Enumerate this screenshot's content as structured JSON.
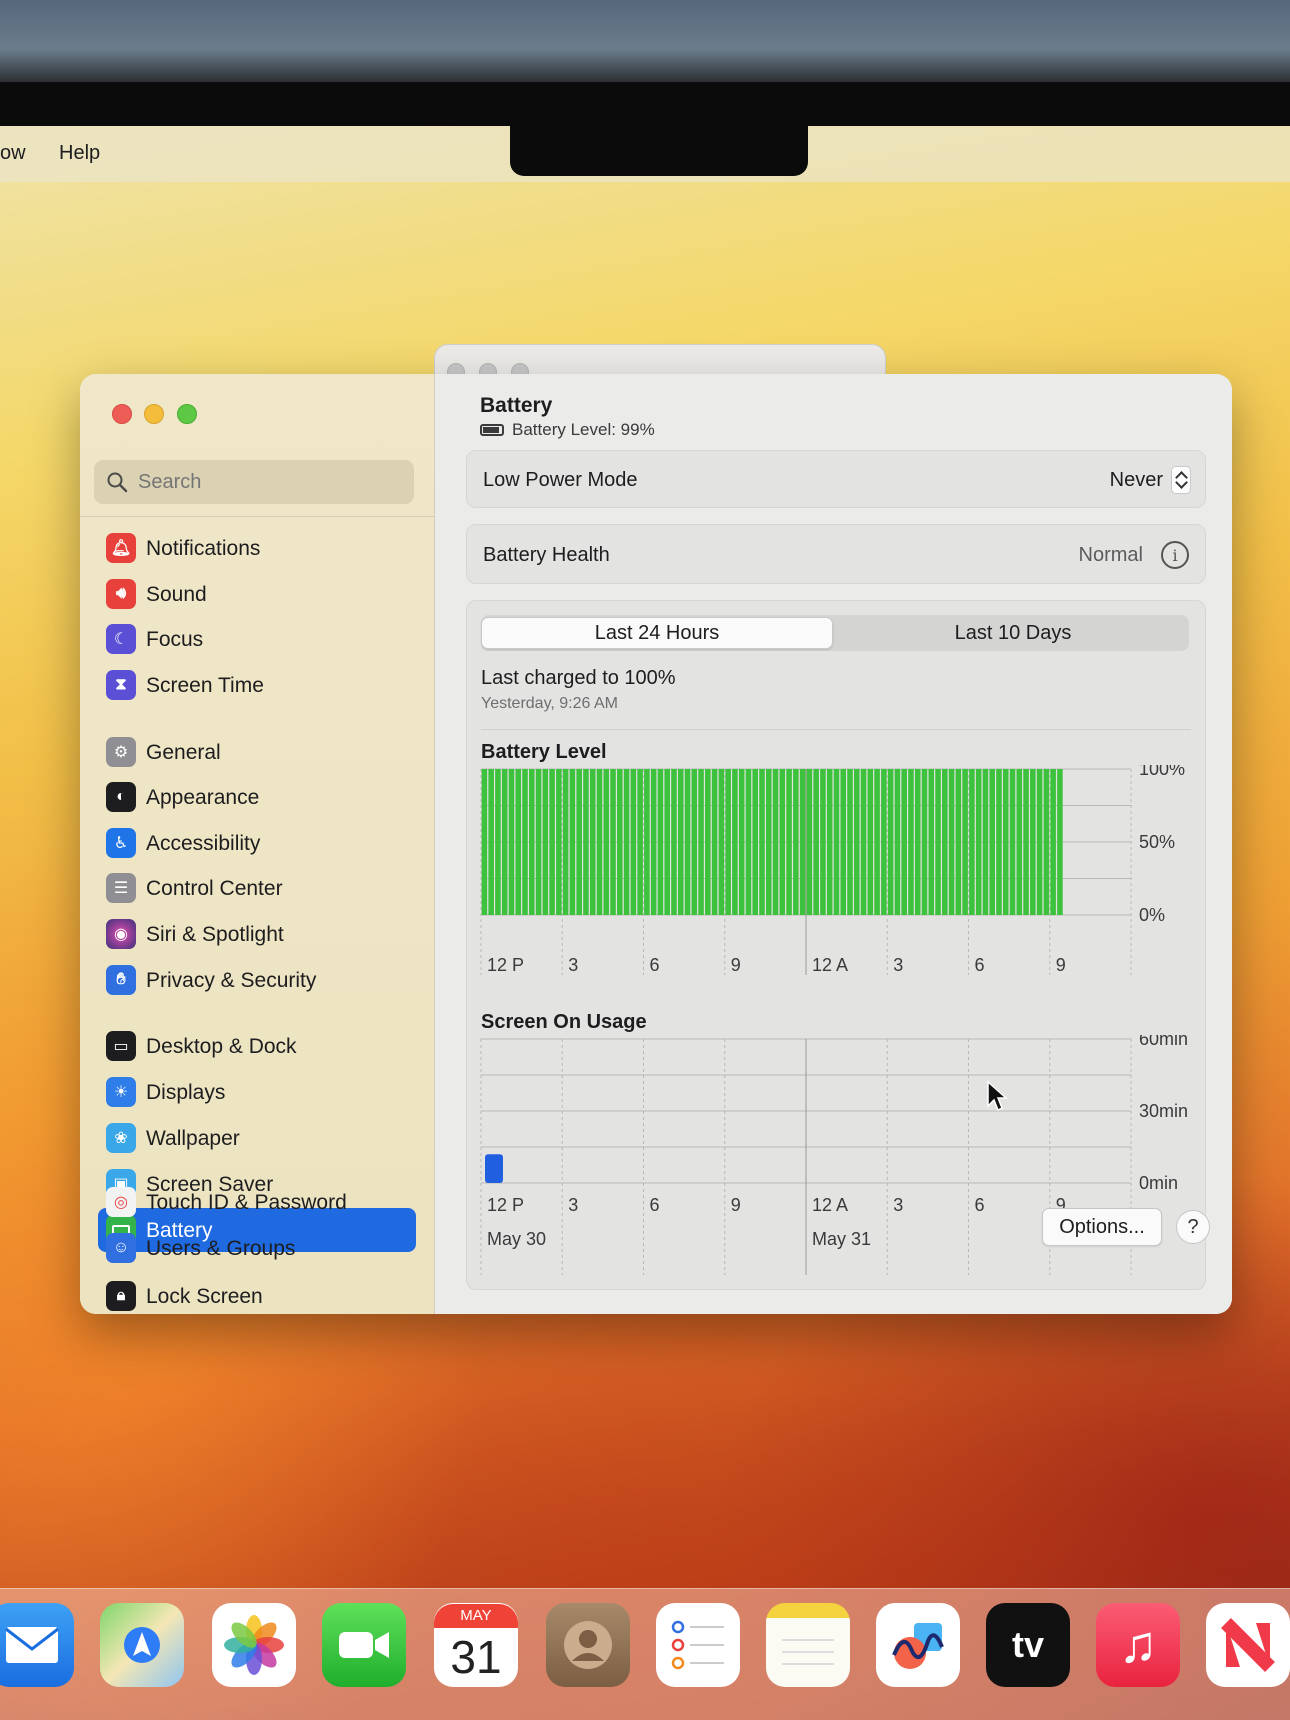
{
  "menubar": {
    "items": [
      "ow",
      "Help"
    ]
  },
  "sidebar": {
    "search_placeholder": "Search",
    "items": [
      {
        "label": "Notifications",
        "color": "#e8413c"
      },
      {
        "label": "Sound",
        "color": "#e8413c"
      },
      {
        "label": "Focus",
        "color": "#5b4fd6"
      },
      {
        "label": "Screen Time",
        "color": "#5b4fd6"
      },
      {
        "label": "General",
        "color": "#8e8e93"
      },
      {
        "label": "Appearance",
        "color": "#1d1d1f"
      },
      {
        "label": "Accessibility",
        "color": "#1f74e8"
      },
      {
        "label": "Control Center",
        "color": "#8e8e93"
      },
      {
        "label": "Siri & Spotlight",
        "color": "#3a2f7a"
      },
      {
        "label": "Privacy & Security",
        "color": "#2f6fe0"
      },
      {
        "label": "Desktop & Dock",
        "color": "#1d1d1f"
      },
      {
        "label": "Displays",
        "color": "#2f7de8"
      },
      {
        "label": "Wallpaper",
        "color": "#3aa7e8"
      },
      {
        "label": "Screen Saver",
        "color": "#3aa7e8"
      },
      {
        "label": "Battery",
        "color": "#33b34a"
      },
      {
        "label": "Lock Screen",
        "color": "#1d1d1f"
      },
      {
        "label": "Touch ID & Password",
        "color": "#f3f3f3"
      },
      {
        "label": "Users & Groups",
        "color": "#2f6fe0"
      }
    ],
    "selected": "Battery"
  },
  "main": {
    "title": "Battery",
    "battery_level_text": "Battery Level: 99%",
    "low_power_mode": {
      "label": "Low Power Mode",
      "value": "Never"
    },
    "battery_health": {
      "label": "Battery Health",
      "value": "Normal"
    },
    "tabs": [
      {
        "label": "Last 24 Hours",
        "active": true
      },
      {
        "label": "Last 10 Days",
        "active": false
      }
    ],
    "last_charged": "Last charged to 100%",
    "last_charged_time": "Yesterday, 9:26 AM",
    "options_label": "Options...",
    "help_label": "?"
  },
  "chart_data": [
    {
      "type": "bar",
      "title": "Battery Level",
      "y_ticks": [
        "100%",
        "50%",
        "0%"
      ],
      "ylim": [
        0,
        100
      ],
      "x_ticks": [
        "12 P",
        "3",
        "6",
        "9",
        "12 A",
        "3",
        "6",
        "9"
      ],
      "bar_count": 72,
      "values_start_hour": 12,
      "values_percent_by_quarter_hour_until": "~9:30 AM",
      "values": 100,
      "bar_color": "#3dc23d"
    },
    {
      "type": "bar",
      "title": "Screen On Usage",
      "y_ticks": [
        "60min",
        "30min",
        "0min"
      ],
      "ylim": [
        0,
        60
      ],
      "x_ticks": [
        "12 P",
        "3",
        "6",
        "9",
        "12 A",
        "3",
        "6",
        "9"
      ],
      "dates": [
        "May 30",
        "May 31"
      ],
      "series": [
        {
          "values": [
            {
              "x": "12 P",
              "minutes": 12
            }
          ]
        }
      ],
      "bar_color": "#1f5fe0"
    }
  ],
  "dock": {
    "calendar_month": "MAY",
    "calendar_day": "31",
    "apps": [
      "mail-icon",
      "maps-icon",
      "photos-icon",
      "facetime-icon",
      "calendar-icon",
      "contacts-icon",
      "reminders-icon",
      "notes-icon",
      "freeform-icon",
      "tv-icon",
      "music-icon",
      "news-icon"
    ],
    "tv_label": "tv"
  }
}
